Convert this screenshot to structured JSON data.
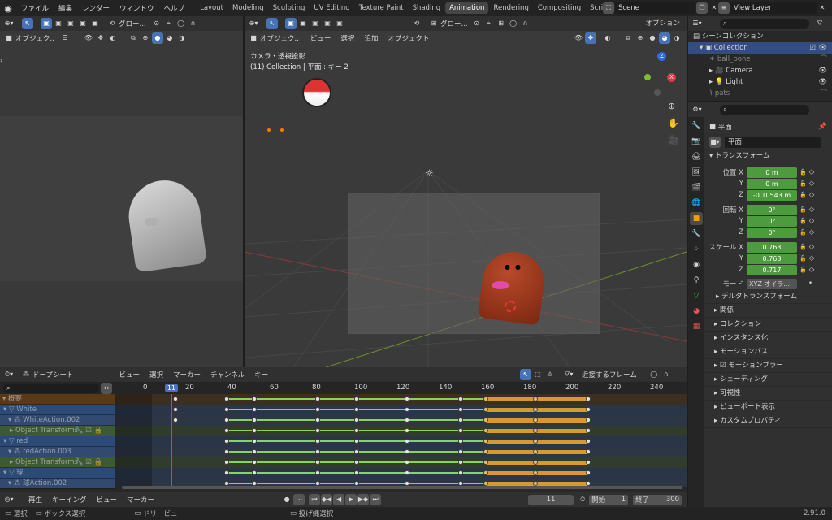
{
  "topbar": {
    "menus": [
      "ファイル",
      "編集",
      "レンダー",
      "ウィンドウ",
      "ヘルプ"
    ],
    "workspaces": [
      "Layout",
      "Modeling",
      "Sculpting",
      "UV Editing",
      "Texture Paint",
      "Shading",
      "Animation",
      "Rendering",
      "Compositing",
      "Scripting"
    ],
    "active_workspace": "Animation",
    "scene": "Scene",
    "view_layer": "View Layer"
  },
  "camera_view": {
    "view_mode": "オブジェク..",
    "orientation": "グロー..."
  },
  "viewport": {
    "orientation": "グロー...",
    "view_mode": "オブジェク..",
    "menus": [
      "ビュー",
      "選択",
      "追加",
      "オブジェクト"
    ],
    "options": "オプション",
    "overlay_title": "カメラ・透視投影",
    "overlay_sub": "(11) Collection | 平面 : キー 2"
  },
  "outliner": {
    "header": "シーンコレクション",
    "items": [
      {
        "name": "Collection"
      },
      {
        "name": "ball_bone"
      },
      {
        "name": "Camera"
      },
      {
        "name": "Light"
      },
      {
        "name": "pats"
      }
    ]
  },
  "properties": {
    "object_name": "平面",
    "data_name": "平面",
    "transform_header": "トランスフォーム",
    "location_label": "位置",
    "rotation_label": "回転",
    "scale_label": "スケール",
    "mode_label": "モード",
    "mode_value": "XYZ オイラ...",
    "location": {
      "x": "0 m",
      "y": "0 m",
      "z": "-0.10543 m"
    },
    "rotation": {
      "x": "0°",
      "y": "0°",
      "z": "0°"
    },
    "scale": {
      "x": "0.763",
      "y": "0.763",
      "z": "0.717"
    },
    "axes": [
      "X",
      "Y",
      "Z"
    ],
    "delta": "デルタトランスフォーム",
    "sections": [
      "関係",
      "コレクション",
      "インスタンス化",
      "モーションパス",
      "モーションブラー",
      "シェーディング",
      "可視性",
      "ビューポート表示",
      "カスタムプロパティ"
    ]
  },
  "dopesheet": {
    "mode": "ドープシート",
    "menus": [
      "ビュー",
      "選択",
      "マーカー",
      "チャンネル",
      "キー"
    ],
    "snap": "近接するフレーム",
    "current_frame_badge": "11",
    "ruler": [
      "0",
      "20",
      "40",
      "60",
      "80",
      "100",
      "120",
      "140",
      "160",
      "180",
      "200",
      "220",
      "240"
    ],
    "channels": [
      {
        "label": "概要",
        "type": "summary"
      },
      {
        "label": "White",
        "type": "object"
      },
      {
        "label": "WhiteAction.002",
        "type": "action"
      },
      {
        "label": "Object Transforms",
        "type": "group"
      },
      {
        "label": "red",
        "type": "object"
      },
      {
        "label": "redAction.003",
        "type": "action"
      },
      {
        "label": "Object Transforms",
        "type": "group"
      },
      {
        "label": "球",
        "type": "object"
      },
      {
        "label": "球Action.002",
        "type": "action"
      }
    ]
  },
  "timeline": {
    "menus": [
      "再生",
      "キーイング",
      "ビュー",
      "マーカー"
    ],
    "frame": "11",
    "start_label": "開始",
    "start": "1",
    "end_label": "終了",
    "end": "300"
  },
  "statusbar": {
    "items": [
      "選択",
      "ボックス選択",
      "ドリービュー",
      "投げ縄選択"
    ],
    "version": "2.91.0"
  }
}
